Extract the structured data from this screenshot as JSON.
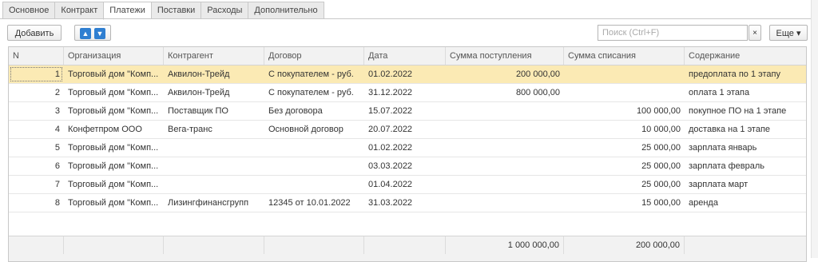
{
  "tabs": [
    "Основное",
    "Контракт",
    "Платежи",
    "Поставки",
    "Расходы",
    "Дополнительно"
  ],
  "active_tab": "Платежи",
  "toolbar": {
    "add_label": "Добавить",
    "move_up_icon": "arrow-up-icon",
    "move_down_icon": "arrow-down-icon",
    "search_placeholder": "Поиск (Ctrl+F)",
    "clear_label": "×",
    "more_label": "Еще ▾"
  },
  "table": {
    "columns": [
      "N",
      "Организация",
      "Контрагент",
      "Договор",
      "Дата",
      "Сумма поступления",
      "Сумма списания",
      "Содержание"
    ],
    "rows": [
      [
        "1",
        "Торговый дом \"Комп...",
        "Аквилон-Трейд",
        "С покупателем - руб.",
        "01.02.2022",
        "200 000,00",
        "",
        "предоплата по 1 этапу"
      ],
      [
        "2",
        "Торговый дом \"Комп...",
        "Аквилон-Трейд",
        "С покупателем - руб.",
        "31.12.2022",
        "800 000,00",
        "",
        "оплата 1 этапа"
      ],
      [
        "3",
        "Торговый дом \"Комп...",
        "Поставщик ПО",
        "Без договора",
        "15.07.2022",
        "",
        "100 000,00",
        "покупное ПО на 1 этапе"
      ],
      [
        "4",
        "Конфетпром ООО",
        "Вега-транс",
        "Основной договор",
        "20.07.2022",
        "",
        "10 000,00",
        "доставка на 1 этапе"
      ],
      [
        "5",
        "Торговый дом \"Комп...",
        "",
        "",
        "01.02.2022",
        "",
        "25 000,00",
        "зарплата январь"
      ],
      [
        "6",
        "Торговый дом \"Комп...",
        "",
        "",
        "03.03.2022",
        "",
        "25 000,00",
        "зарплата февраль"
      ],
      [
        "7",
        "Торговый дом \"Комп...",
        "",
        "",
        "01.04.2022",
        "",
        "25 000,00",
        "зарплата март"
      ],
      [
        "8",
        "Торговый дом \"Комп...",
        "Лизингфинансгрупп",
        "12345 от 10.01.2022",
        "31.03.2022",
        "",
        "15 000,00",
        "аренда"
      ]
    ],
    "selected_row": 1,
    "totals": {
      "income": "1 000 000,00",
      "expense": "200 000,00"
    }
  },
  "colors": {
    "selected_row": "#fbeab4",
    "arrow_button": "#2f7fd1",
    "header_bg": "#f2f2f2"
  }
}
